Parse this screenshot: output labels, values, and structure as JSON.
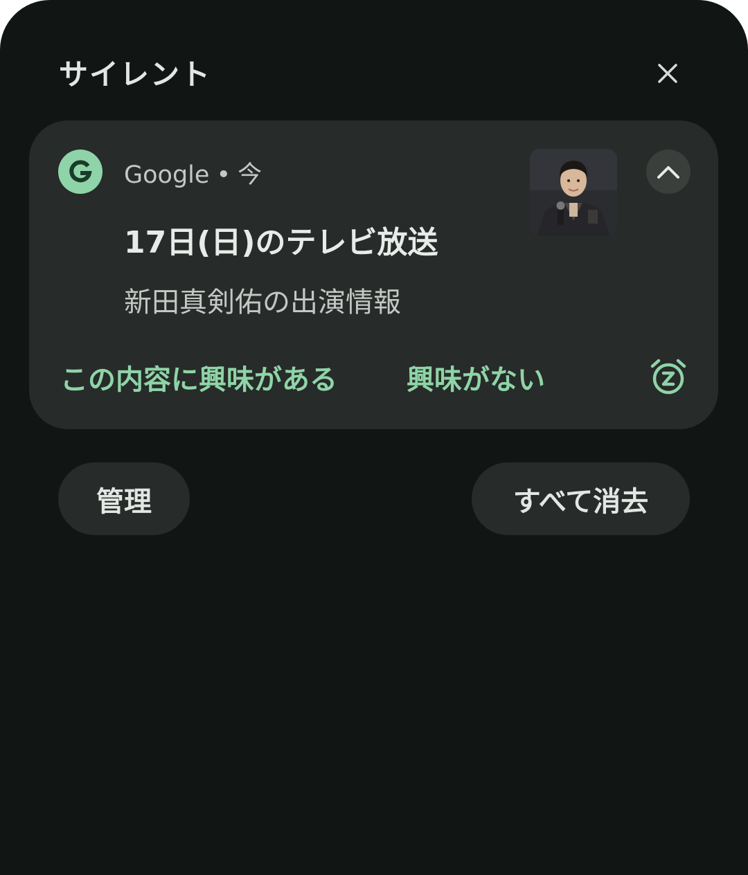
{
  "section": {
    "title": "サイレント",
    "close_icon": "close-icon"
  },
  "notification": {
    "app_icon": "google-g-icon",
    "app_icon_letter": "G",
    "app_name": "Google",
    "separator": "•",
    "time": "今",
    "title": "17日(日)のテレビ放送",
    "body": "新田真剣佑の出演情報",
    "expand_icon": "chevron-up-icon",
    "actions": [
      {
        "label": "この内容に興味がある"
      },
      {
        "label": "興味がない"
      }
    ],
    "snooze_icon": "snooze-alarm-icon"
  },
  "footer": {
    "manage_label": "管理",
    "clear_all_label": "すべて消去"
  },
  "colors": {
    "background": "#111614",
    "card": "#272b29",
    "accent": "#8fd4a8",
    "text_primary": "#e8ece9",
    "text_secondary": "#c3c8c4"
  }
}
